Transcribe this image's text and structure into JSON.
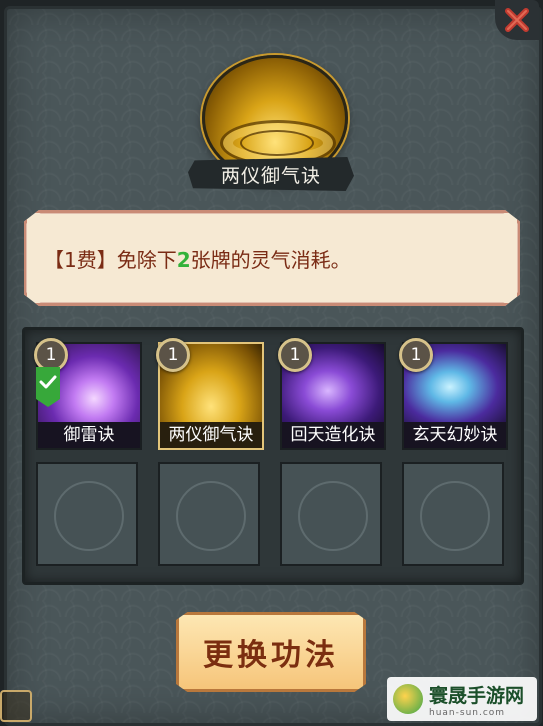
{
  "skill": {
    "name": "两仪御气诀",
    "description_prefix": "【1费】免除下",
    "description_number": "2",
    "description_suffix": "张牌的灵气消耗。"
  },
  "cards": [
    {
      "name": "御雷诀",
      "cost": "1",
      "selected_check": true,
      "art": "purple-lightning"
    },
    {
      "name": "两仪御气诀",
      "cost": "1",
      "highlighted": true,
      "art": "golden-swirl"
    },
    {
      "name": "回天造化诀",
      "cost": "1",
      "art": "purple-figure"
    },
    {
      "name": "玄天幻妙诀",
      "cost": "1",
      "art": "blue-wings"
    }
  ],
  "empty_slots": 4,
  "change_button": {
    "label": "更换功法"
  },
  "watermark": {
    "title": "寰晟手游网",
    "sub": "huan-sun.com"
  },
  "colors": {
    "panel": "#4a5659",
    "desc_bg": "#f6e9d3",
    "desc_text": "#7a2b14",
    "highlight_number": "#33b23a",
    "button_bg": "#f6c57a"
  }
}
